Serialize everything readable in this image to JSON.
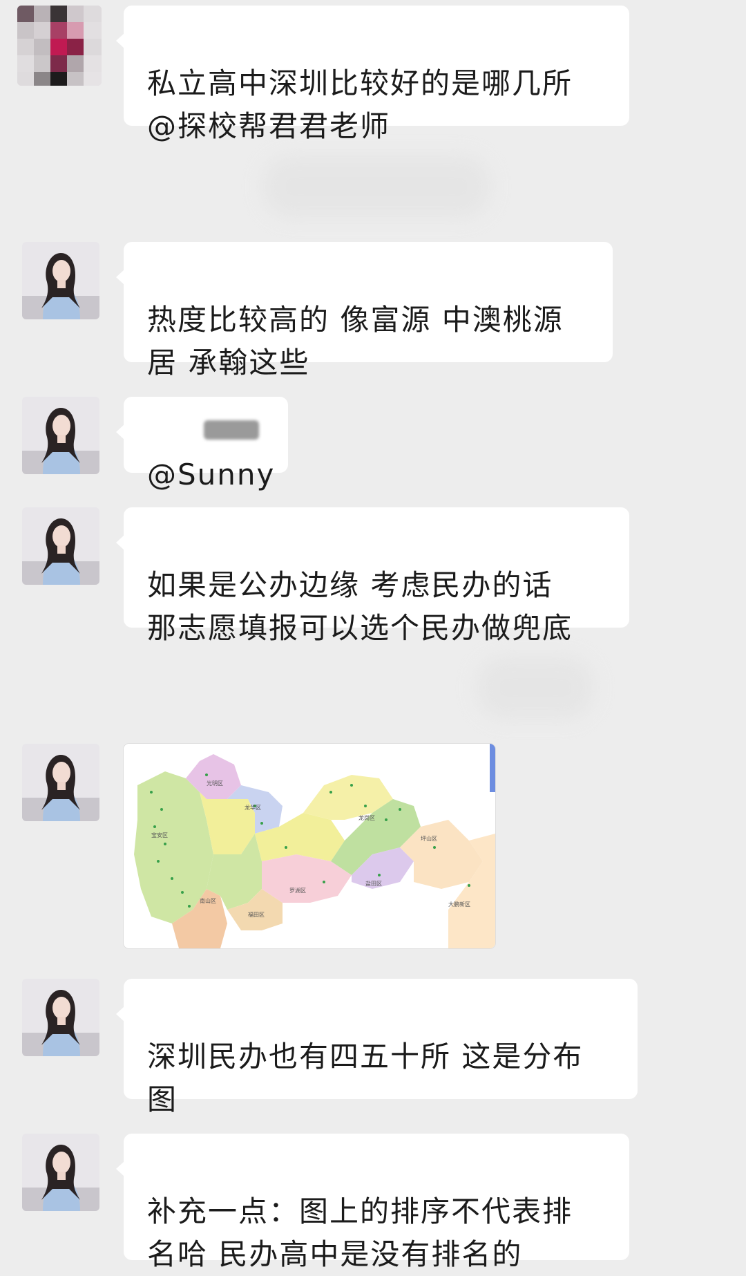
{
  "messages": [
    {
      "sender_avatar": "pixelated-avatar",
      "text": "私立高中深圳比较好的是哪几所\n@探校帮君君老师"
    },
    {
      "sender_avatar": "teacher-avatar",
      "text": "热度比较高的 像富源 中澳桃源\n居 承翰这些"
    },
    {
      "sender_avatar": "teacher-avatar",
      "text": "@Sunny"
    },
    {
      "sender_avatar": "teacher-avatar",
      "text": "如果是公办边缘 考虑民办的话\n那志愿填报可以选个民办做兜底"
    },
    {
      "sender_avatar": "teacher-avatar",
      "image": "shenzhen-district-map",
      "map_labels": [
        "光明区",
        "宝安区",
        "龙华区",
        "龙岗区",
        "南山区",
        "福田区",
        "罗湖区",
        "盐田区",
        "坪山区",
        "大鹏新区"
      ]
    },
    {
      "sender_avatar": "teacher-avatar",
      "text": "深圳民办也有四五十所 这是分布\n图"
    },
    {
      "sender_avatar": "teacher-avatar",
      "text": "补充一点：图上的排序不代表排\n名哈 民办高中是没有排名的"
    }
  ],
  "colors": {
    "background": "#ededed",
    "bubble": "#ffffff",
    "text": "#1b1b1b"
  }
}
